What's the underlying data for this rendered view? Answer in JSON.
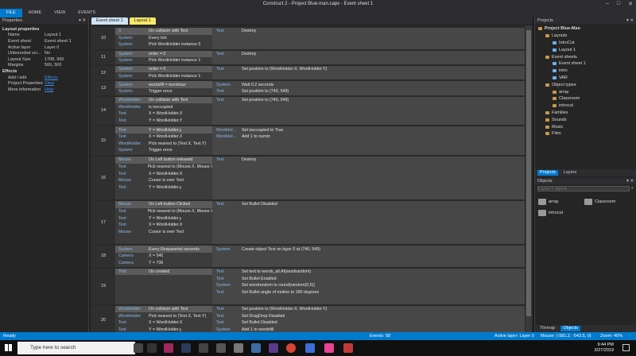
{
  "window": {
    "title": "Construct 2 - Project Blue-man.capx - Event sheet 1"
  },
  "ribbon": {
    "tabs": [
      "FILE",
      "HOME",
      "VIEW",
      "EVENTS"
    ]
  },
  "properties": {
    "header": "Properties",
    "rows": [
      {
        "k": "Layout properties",
        "v": "",
        "cat": true
      },
      {
        "k": "Name",
        "v": "Layout 1"
      },
      {
        "k": "Event sheet",
        "v": "Event sheet 1"
      },
      {
        "k": "Active layer",
        "v": "Layer 0"
      },
      {
        "k": "Unbounded scr...",
        "v": "No"
      },
      {
        "k": "Layout Size",
        "v": "1708, 960"
      },
      {
        "k": "Margins",
        "v": "500, 500"
      },
      {
        "k": "Effects",
        "v": "",
        "cat": true
      },
      {
        "k": "Add / edit",
        "v": "Effects",
        "link": true
      },
      {
        "k": "Project Properties",
        "v": "View",
        "link": true
      },
      {
        "k": "More information",
        "v": "Help",
        "link": true
      }
    ]
  },
  "doc_tabs": [
    "Event sheet 1",
    "Layout 1"
  ],
  "events": [
    {
      "num": "10",
      "h": 27,
      "conds": [
        [
          "X",
          "On collision with Text"
        ],
        [
          "System",
          "Every tick"
        ],
        [
          "System",
          "Pick WordHolder instance 0"
        ]
      ],
      "acts": [
        [
          "Text",
          "Destroy"
        ]
      ]
    },
    {
      "num": "11",
      "h": 18,
      "conds": [
        [
          "System",
          "order = 0"
        ],
        [
          "System",
          "Pick WordHolder instance 1"
        ]
      ],
      "acts": [
        [
          "Text",
          "Destroy"
        ]
      ]
    },
    {
      "num": "12",
      "h": 18,
      "conds": [
        [
          "System",
          "order = 0"
        ],
        [
          "System",
          "Pick WordHolder instance 1"
        ]
      ],
      "acts": [
        [
          "Text",
          "Set position to (WordHolder.X, WordHolder.Y)"
        ]
      ]
    },
    {
      "num": "13",
      "h": 18,
      "conds": [
        [
          "System",
          "wordsfill = wordmax"
        ],
        [
          "System",
          "Trigger once"
        ]
      ],
      "acts": [
        [
          "System",
          "Wait 0.2 seconds"
        ],
        [
          "Text",
          "Set position to (740, 549)"
        ]
      ]
    },
    {
      "num": "14",
      "h": 36,
      "conds": [
        [
          "WordHolder",
          "On collision with Text"
        ],
        [
          "WordHolder",
          "is isoccupied"
        ],
        [
          "Text",
          "X = WordHolder.X"
        ],
        [
          "Text",
          "Y = WordHolder.Y"
        ]
      ],
      "acts": [
        [
          "Text",
          "Set position to (740, 549)"
        ]
      ]
    },
    {
      "num": "15",
      "h": 36,
      "conds": [
        [
          "Text",
          "Y = WordHolder.y"
        ],
        [
          "Text",
          "X = WordHolder.X"
        ],
        [
          "WordHolder",
          "Pick nearest to (Text.X, Text.Y)"
        ],
        [
          "System",
          "Trigger once"
        ]
      ],
      "acts": [
        [
          "WordHol...",
          "Set isoccupied to True"
        ],
        [
          "WordHol...",
          "Add 1 to numin"
        ]
      ]
    },
    {
      "num": "16",
      "h": 54,
      "conds": [
        [
          "Mouse",
          "On Left button released"
        ],
        [
          "Text",
          "Pick nearest to (Mouse.X, Mouse.Y)"
        ],
        [
          "Text",
          "X = WordHolder.X"
        ],
        [
          "Mouse",
          "Cursor is over Text"
        ],
        [
          "Text",
          "Y = WordHolder.y"
        ]
      ],
      "acts": [
        [
          "Text",
          "Destroy"
        ]
      ]
    },
    {
      "num": "17",
      "h": 54,
      "conds": [
        [
          "Mouse",
          "On Left button Clicked"
        ],
        [
          "Text",
          "Pick nearest to (Mouse.X, Mouse.Y)"
        ],
        [
          "Text",
          "Y = WordHolder.y"
        ],
        [
          "Text",
          "X = WordHolder.X"
        ],
        [
          "Mouse",
          "Cursor is over Text"
        ]
      ],
      "acts": [
        [
          "Text",
          "Set Bullet Disabled"
        ]
      ]
    },
    {
      "num": "18",
      "h": 27,
      "conds": [
        [
          "System",
          "Every Respawntel seconds"
        ],
        [
          "Camera",
          "X = 540"
        ],
        [
          "Camera",
          "Y = 736"
        ]
      ],
      "acts": [
        [
          "System",
          "Create object Text on layer 0 at (740, 549)"
        ]
      ]
    },
    {
      "num": "19",
      "h": 45,
      "conds": [
        [
          "Text",
          "On created"
        ]
      ],
      "acts": [
        [
          "Text",
          "Set text to words_all.At(wordrandom)"
        ],
        [
          "Text",
          "Set Bullet Enabled"
        ],
        [
          "System",
          "Set wordrandom to round(random(0,5))"
        ],
        [
          "Text",
          "Set Bullet angle of motion to 180 degrees"
        ]
      ]
    },
    {
      "num": "20",
      "h": 36,
      "conds": [
        [
          "WordHolder",
          "On collision with Text"
        ],
        [
          "WordHolder",
          "Pick nearest to (Text.X, Text.Y)"
        ],
        [
          "Text",
          "X = WordHolder.X"
        ],
        [
          "Text",
          "Y = WordHolder.y"
        ]
      ],
      "acts": [
        [
          "Text",
          "Set position to (WordHolder.X, WordHolder.Y)"
        ],
        [
          "Text",
          "Set DragDrop Disabled"
        ],
        [
          "Text",
          "Set Bullet Disabled"
        ],
        [
          "System",
          "Add 1 to wordsfill"
        ]
      ]
    }
  ],
  "projects": {
    "header": "Projects",
    "tree": [
      {
        "label": "Project Blue-Man",
        "indent": 0,
        "icon": "fold",
        "bold": true
      },
      {
        "label": "Layouts",
        "indent": 1,
        "icon": "fold"
      },
      {
        "label": "IntroCut",
        "indent": 2,
        "icon": "doc"
      },
      {
        "label": "Layout 1",
        "indent": 2,
        "icon": "doc"
      },
      {
        "label": "Event sheets",
        "indent": 1,
        "icon": "fold"
      },
      {
        "label": "Event sheet 1",
        "indent": 2,
        "icon": "doc"
      },
      {
        "label": "intro",
        "indent": 2,
        "icon": "doc"
      },
      {
        "label": "VAR",
        "indent": 2,
        "icon": "doc"
      },
      {
        "label": "Object types",
        "indent": 1,
        "icon": "fold"
      },
      {
        "label": "array",
        "indent": 2,
        "icon": "fold"
      },
      {
        "label": "Classroom",
        "indent": 2,
        "icon": "fold"
      },
      {
        "label": "introcut",
        "indent": 2,
        "icon": "fold"
      },
      {
        "label": "Families",
        "indent": 1,
        "icon": "fold"
      },
      {
        "label": "Sounds",
        "indent": 1,
        "icon": "fold"
      },
      {
        "label": "Music",
        "indent": 1,
        "icon": "fold"
      },
      {
        "label": "Files",
        "indent": 1,
        "icon": "fold"
      }
    ],
    "bottom_tabs": [
      "Projects",
      "Layers"
    ]
  },
  "objects": {
    "header": "Objects",
    "search_placeholder": "Layout 1 objects",
    "items": [
      "array",
      "Classroom",
      "introcut"
    ],
    "bottom_tabs": [
      "Tilemap",
      "Objects"
    ]
  },
  "status": {
    "left": "Ready",
    "events": "Events: 58",
    "layer": "Active layer: Layer 0",
    "mouse": "Mouse: (-581.2, -543.5, 0)",
    "zoom": "Zoom: 40%"
  },
  "taskbar": {
    "search_placeholder": "Type here to search",
    "time": "9:44 PM",
    "date": "3/27/2019"
  },
  "colors": {
    "accent": "#007acc"
  }
}
